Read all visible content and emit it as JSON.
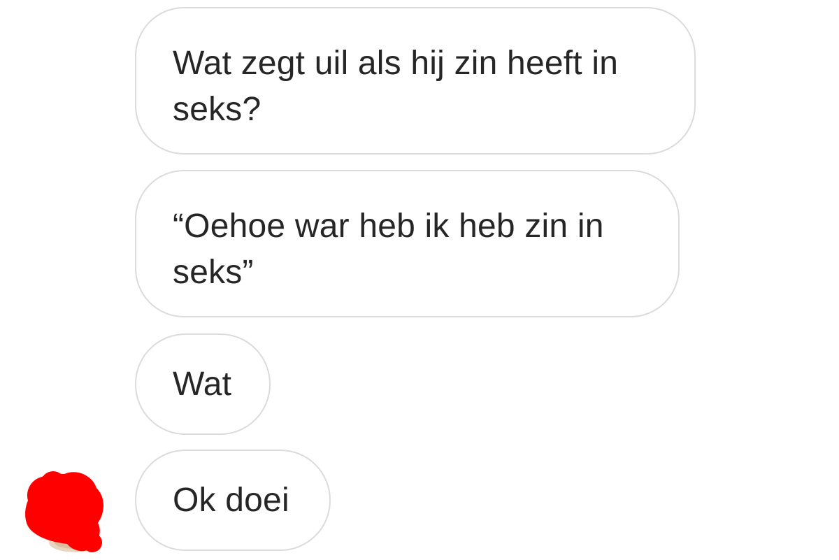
{
  "conversation": {
    "messages": [
      {
        "text": "Wat zegt uil als hij zin heeft in seks?"
      },
      {
        "text": "“Oehoe war heb ik heb zin in seks”"
      },
      {
        "text": "Wat"
      },
      {
        "text": "Ok doei"
      }
    ],
    "sender_avatar": {
      "icon": "redacted-avatar-icon",
      "redaction_color": "#ff0000"
    },
    "colors": {
      "background": "#ffffff",
      "bubble_border": "#dbdbdb",
      "text": "#262626"
    }
  }
}
